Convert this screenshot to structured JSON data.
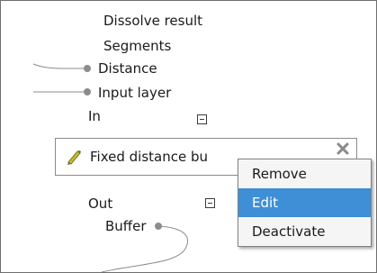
{
  "params_in": [
    {
      "label": "Dissolve result"
    },
    {
      "label": "Segments"
    },
    {
      "label": "Distance"
    },
    {
      "label": "Input layer"
    }
  ],
  "in_label": "In",
  "algorithm": {
    "name": "Fixed distance bu",
    "icon": "pencil-icon"
  },
  "out_label": "Out",
  "output": {
    "label": "Buffer"
  },
  "context_menu": {
    "items": [
      {
        "label": "Remove",
        "selected": false
      },
      {
        "label": "Edit",
        "selected": true
      },
      {
        "label": "Deactivate",
        "selected": false
      }
    ],
    "highlight_color": "#3e8fd6"
  },
  "colors": {
    "wire": "#8c8c8c",
    "border": "#6f6f6f"
  }
}
